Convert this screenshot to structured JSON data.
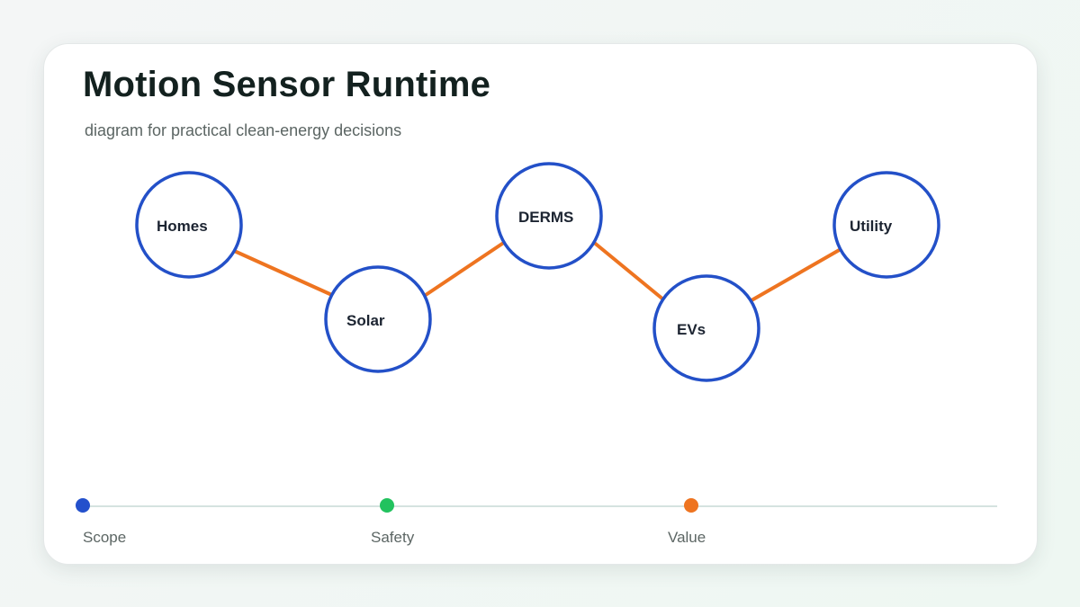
{
  "header": {
    "title": "Motion Sensor Runtime",
    "subtitle": "diagram for practical clean-energy decisions"
  },
  "diagram": {
    "nodes": [
      {
        "id": "homes",
        "label": "Homes"
      },
      {
        "id": "solar",
        "label": "Solar"
      },
      {
        "id": "derms",
        "label": "DERMS"
      },
      {
        "id": "evs",
        "label": "EVs"
      },
      {
        "id": "utility",
        "label": "Utility"
      }
    ],
    "edges": [
      {
        "from": "homes",
        "to": "solar"
      },
      {
        "from": "solar",
        "to": "derms"
      },
      {
        "from": "derms",
        "to": "evs"
      },
      {
        "from": "evs",
        "to": "utility"
      }
    ]
  },
  "legend": {
    "items": [
      {
        "label": "Scope",
        "color": "#2350cc"
      },
      {
        "label": "Safety",
        "color": "#22c25e"
      },
      {
        "label": "Value",
        "color": "#ee7420"
      }
    ]
  },
  "colors": {
    "node_stroke": "#2350c8",
    "edge": "#ee7420",
    "track": "#d5e3e0"
  }
}
